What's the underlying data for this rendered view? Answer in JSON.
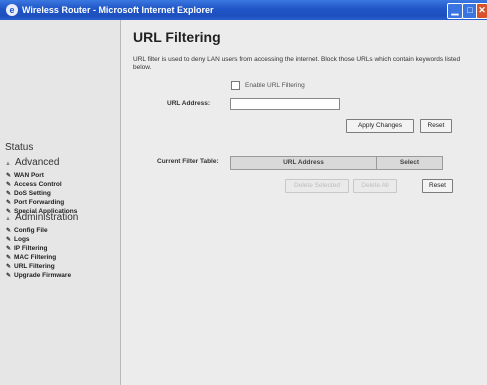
{
  "window": {
    "title": "Wireless Router - Microsoft Internet Explorer",
    "icon": "ie-icon"
  },
  "sidebar": {
    "status_label": "Status",
    "advanced": {
      "heading": "Advanced",
      "items": [
        "WAN Port",
        "Access Control",
        "DoS Setting",
        "Port Forwarding",
        "Special Applications"
      ]
    },
    "administration": {
      "heading": "Administration",
      "items": [
        "Config File",
        "Logs",
        "IP Filtering",
        "MAC Filtering",
        "URL Filtering",
        "Upgrade Firmware"
      ]
    }
  },
  "page": {
    "title": "URL Filtering",
    "description": "URL filter is used to deny LAN users from accessing the internet. Block those URLs which contain keywords listed below.",
    "enable_label": "Enable URL Filtering",
    "enable_checked": false,
    "url_address_label": "URL Address:",
    "url_address_value": "",
    "apply_button": "Apply Changes",
    "reset_button": "Reset",
    "current_filter_label": "Current Filter Table:",
    "table_headers": [
      "URL Address",
      "Select"
    ],
    "delete_selected_button": "Delete Selected",
    "delete_all_button": "Delete All",
    "reset_button_2": "Reset"
  }
}
